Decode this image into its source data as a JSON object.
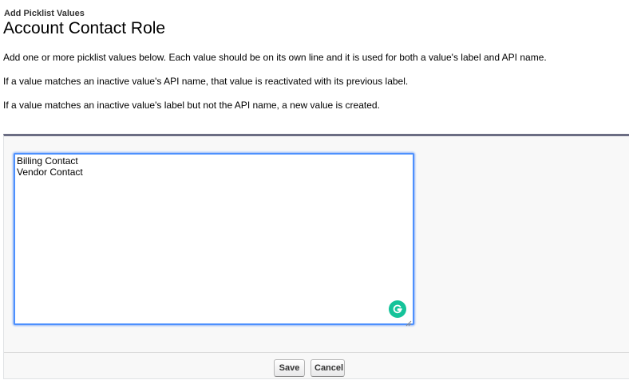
{
  "header": {
    "subtitle": "Add Picklist Values",
    "title": "Account Contact Role"
  },
  "instructions": [
    "Add one or more picklist values below. Each value should be on its own line and it is used for both a value's label and API name.",
    "If a value matches an inactive value's API name, that value is reactivated with its previous label.",
    "If a value matches an inactive value's label but not the API name, a new value is created."
  ],
  "form": {
    "values_text": "Billing Contact\nVendor Contact",
    "save_label": "Save",
    "cancel_label": "Cancel"
  },
  "colors": {
    "panel_border_top": "#6b6d83",
    "focus_border": "#4d90fe",
    "grammarly": "#15c39a"
  },
  "icons": {
    "grammarly": "grammarly-icon",
    "resize": "resize-handle-icon"
  }
}
